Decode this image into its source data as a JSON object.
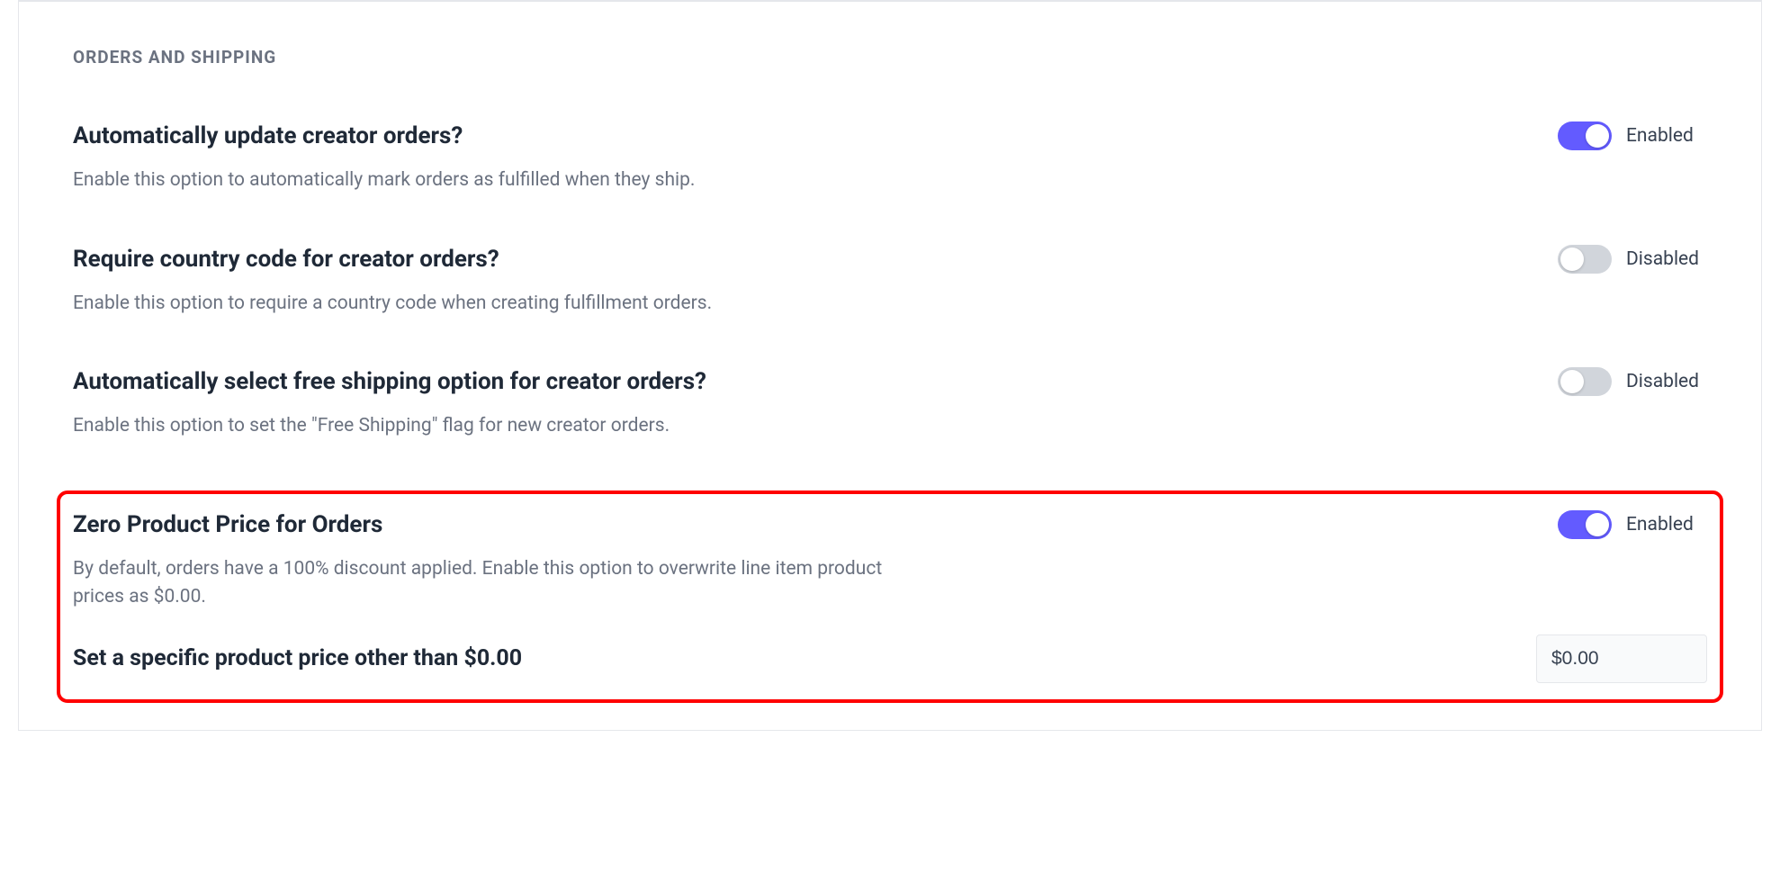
{
  "section": {
    "header": "ORDERS AND SHIPPING"
  },
  "settings": [
    {
      "title": "Automatically update creator orders?",
      "description": "Enable this option to automatically mark orders as fulfilled when they ship.",
      "status": "Enabled"
    },
    {
      "title": "Require country code for creator orders?",
      "description": "Enable this option to require a country code when creating fulfillment orders.",
      "status": "Disabled"
    },
    {
      "title": "Automatically select free shipping option for creator orders?",
      "description": "Enable this option to set the \"Free Shipping\" flag for new creator orders.",
      "status": "Disabled"
    },
    {
      "title": "Zero Product Price for Orders",
      "description": "By default, orders have a 100% discount applied. Enable this option to overwrite line item product prices as $0.00.",
      "status": "Enabled"
    }
  ],
  "price_override": {
    "label": "Set a specific product price other than $0.00",
    "value": "$0.00"
  }
}
